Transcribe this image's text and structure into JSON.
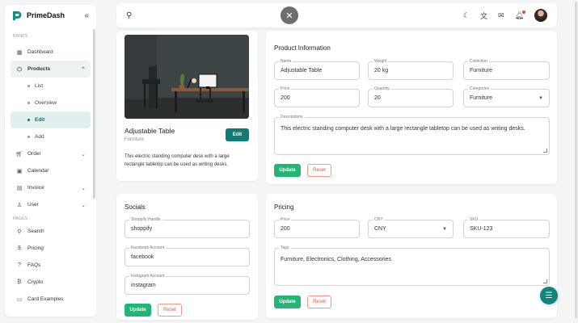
{
  "brand": {
    "name": "PrimeDash",
    "collapse_icon": "double-chevron-left-icon"
  },
  "sidebar": {
    "section_banks": "BANKS",
    "section_pages": "PAGES",
    "items": [
      {
        "label": "Dashboard",
        "icon": "grid-icon"
      },
      {
        "label": "Products",
        "icon": "box-icon"
      },
      {
        "label": "List"
      },
      {
        "label": "Overview"
      },
      {
        "label": "Edit"
      },
      {
        "label": "Add"
      },
      {
        "label": "Order",
        "icon": "cart-icon"
      },
      {
        "label": "Calendar",
        "icon": "calendar-icon"
      },
      {
        "label": "Invoice",
        "icon": "file-icon"
      },
      {
        "label": "User",
        "icon": "user-icon"
      },
      {
        "label": "Search",
        "icon": "search-icon"
      },
      {
        "label": "Pricing",
        "icon": "dollar-icon"
      },
      {
        "label": "FAQs",
        "icon": "help-icon"
      },
      {
        "label": "Crypto",
        "icon": "bitcoin-icon"
      },
      {
        "label": "Card Examples",
        "icon": "card-icon"
      }
    ]
  },
  "topbar": {
    "close_glyph": "✕"
  },
  "product_card": {
    "title": "Adjustable Table",
    "category": "Furniture",
    "edit_label": "Edit",
    "description": "This electric standing computer desk with a large rectangle tabletop can be used as writing desks."
  },
  "product_info": {
    "title": "Product Information",
    "name_label": "Name",
    "name_value": "Adjustable Table",
    "weight_label": "Weight",
    "weight_value": "20 kg",
    "collection_label": "Collection",
    "collection_value": "Furniture",
    "price_label": "Price",
    "price_value": "200",
    "quantity_label": "Quantity",
    "quantity_value": "20",
    "categories_label": "Categories",
    "categories_value": "Furniture",
    "description_label": "Descriptions",
    "description_value": "This electric standing computer desk with a large rectangle tabletop can be used as writing desks.",
    "update_label": "Update",
    "reset_label": "Reset"
  },
  "socials": {
    "title": "Socials",
    "shopify_label": "Shoppify Handle",
    "shopify_value": "shoppify",
    "facebook_label": "Facebook Account",
    "facebook_value": "facebook",
    "instagram_label": "Instagram Account",
    "instagram_value": "instagram",
    "update_label": "Update",
    "reset_label": "Reset"
  },
  "pricing": {
    "title": "Pricing",
    "price_label": "Price",
    "price_value": "200",
    "currency_label": "CNY",
    "currency_value": "CNY",
    "sku_label": "SKU",
    "sku_value": "SKU-123",
    "tags_label": "Tags",
    "tags_value": "Furniture, Electronics, Clothing, Accessories",
    "update_label": "Update",
    "reset_label": "Reset"
  },
  "colors": {
    "accent": "#117a72",
    "success": "#22b573",
    "danger": "#e2553a"
  }
}
